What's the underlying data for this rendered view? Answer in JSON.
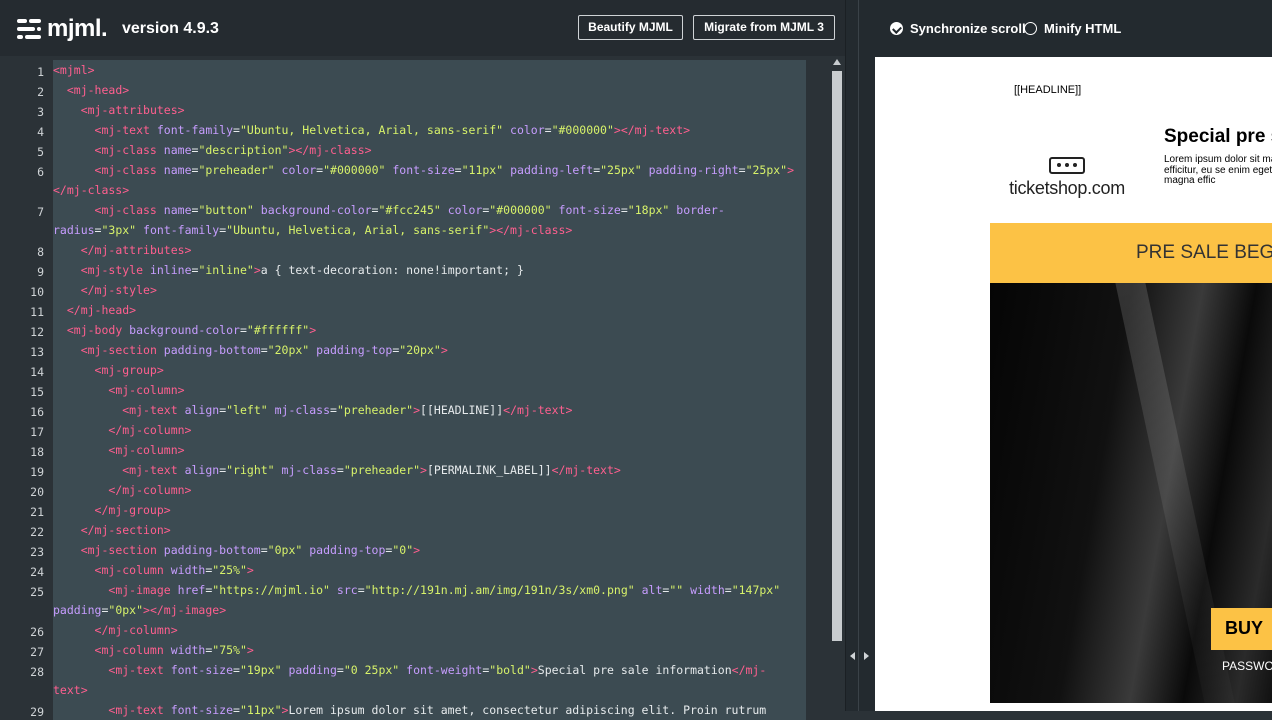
{
  "header": {
    "logo_text": "mjml.",
    "version": "version 4.9.3",
    "beautify_label": "Beautify MJML",
    "migrate_label": "Migrate from MJML 3"
  },
  "options": {
    "sync_scroll_label": "Synchronize scroll",
    "sync_scroll_checked": true,
    "minify_label": "Minify HTML",
    "minify_checked": false
  },
  "editor": {
    "line_numbers": [
      "1",
      "2",
      "3",
      "4",
      "5",
      "6",
      "7",
      "8",
      "9",
      "10",
      "11",
      "12",
      "13",
      "14",
      "15",
      "16",
      "17",
      "18",
      "19",
      "20",
      "21",
      "22",
      "23",
      "24",
      "25",
      "26",
      "27",
      "28",
      "29"
    ],
    "lines": [
      [
        [
          "t",
          "<mjml>"
        ]
      ],
      [
        [
          "x",
          "  "
        ],
        [
          "t",
          "<mj-head>"
        ]
      ],
      [
        [
          "x",
          "    "
        ],
        [
          "t",
          "<mj-attributes>"
        ]
      ],
      [
        [
          "x",
          "      "
        ],
        [
          "t",
          "<mj-text "
        ],
        [
          "a",
          "font-family"
        ],
        [
          "x",
          "="
        ],
        [
          "s",
          "\"Ubuntu, Helvetica, Arial, sans-serif\""
        ],
        [
          "x",
          " "
        ],
        [
          "a",
          "color"
        ],
        [
          "x",
          "="
        ],
        [
          "s",
          "\"#000000\""
        ],
        [
          "t",
          "></mj-text>"
        ]
      ],
      [
        [
          "x",
          "      "
        ],
        [
          "t",
          "<mj-class "
        ],
        [
          "a",
          "name"
        ],
        [
          "x",
          "="
        ],
        [
          "s",
          "\"description\""
        ],
        [
          "t",
          "></mj-class>"
        ]
      ],
      [
        [
          "x",
          "      "
        ],
        [
          "t",
          "<mj-class "
        ],
        [
          "a",
          "name"
        ],
        [
          "x",
          "="
        ],
        [
          "s",
          "\"preheader\""
        ],
        [
          "x",
          " "
        ],
        [
          "a",
          "color"
        ],
        [
          "x",
          "="
        ],
        [
          "s",
          "\"#000000\""
        ],
        [
          "x",
          " "
        ],
        [
          "a",
          "font-size"
        ],
        [
          "x",
          "="
        ],
        [
          "s",
          "\"11px\""
        ],
        [
          "x",
          " "
        ],
        [
          "a",
          "padding-left"
        ],
        [
          "x",
          "="
        ],
        [
          "s",
          "\"25px\""
        ],
        [
          "x",
          " "
        ],
        [
          "a",
          "padding-right"
        ],
        [
          "x",
          "="
        ],
        [
          "s",
          "\"25px\""
        ],
        [
          "t",
          ">"
        ]
      ],
      [
        [
          "t",
          "</mj-class>"
        ]
      ],
      [
        [
          "x",
          "      "
        ],
        [
          "t",
          "<mj-class "
        ],
        [
          "a",
          "name"
        ],
        [
          "x",
          "="
        ],
        [
          "s",
          "\"button\""
        ],
        [
          "x",
          " "
        ],
        [
          "a",
          "background-color"
        ],
        [
          "x",
          "="
        ],
        [
          "s",
          "\"#fcc245\""
        ],
        [
          "x",
          " "
        ],
        [
          "a",
          "color"
        ],
        [
          "x",
          "="
        ],
        [
          "s",
          "\"#000000\""
        ],
        [
          "x",
          " "
        ],
        [
          "a",
          "font-size"
        ],
        [
          "x",
          "="
        ],
        [
          "s",
          "\"18px\""
        ],
        [
          "x",
          " "
        ],
        [
          "a",
          "border-"
        ]
      ],
      [
        [
          "a",
          "radius"
        ],
        [
          "x",
          "="
        ],
        [
          "s",
          "\"3px\""
        ],
        [
          "x",
          " "
        ],
        [
          "a",
          "font-family"
        ],
        [
          "x",
          "="
        ],
        [
          "s",
          "\"Ubuntu, Helvetica, Arial, sans-serif\""
        ],
        [
          "t",
          "></mj-class>"
        ]
      ],
      [
        [
          "x",
          "    "
        ],
        [
          "t",
          "</mj-attributes>"
        ]
      ],
      [
        [
          "x",
          "    "
        ],
        [
          "t",
          "<mj-style "
        ],
        [
          "a",
          "inline"
        ],
        [
          "x",
          "="
        ],
        [
          "s",
          "\"inline\""
        ],
        [
          "t",
          ">"
        ],
        [
          "x",
          "a { text-decoration: none!important; }"
        ]
      ],
      [
        [
          "x",
          "    "
        ],
        [
          "t",
          "</mj-style>"
        ]
      ],
      [
        [
          "x",
          "  "
        ],
        [
          "t",
          "</mj-head>"
        ]
      ],
      [
        [
          "x",
          "  "
        ],
        [
          "t",
          "<mj-body "
        ],
        [
          "a",
          "background-color"
        ],
        [
          "x",
          "="
        ],
        [
          "s",
          "\"#ffffff\""
        ],
        [
          "t",
          ">"
        ]
      ],
      [
        [
          "x",
          "    "
        ],
        [
          "t",
          "<mj-section "
        ],
        [
          "a",
          "padding-bottom"
        ],
        [
          "x",
          "="
        ],
        [
          "s",
          "\"20px\""
        ],
        [
          "x",
          " "
        ],
        [
          "a",
          "padding-top"
        ],
        [
          "x",
          "="
        ],
        [
          "s",
          "\"20px\""
        ],
        [
          "t",
          ">"
        ]
      ],
      [
        [
          "x",
          "      "
        ],
        [
          "t",
          "<mj-group>"
        ]
      ],
      [
        [
          "x",
          "        "
        ],
        [
          "t",
          "<mj-column>"
        ]
      ],
      [
        [
          "x",
          "          "
        ],
        [
          "t",
          "<mj-text "
        ],
        [
          "a",
          "align"
        ],
        [
          "x",
          "="
        ],
        [
          "s",
          "\"left\""
        ],
        [
          "x",
          " "
        ],
        [
          "a",
          "mj-class"
        ],
        [
          "x",
          "="
        ],
        [
          "s",
          "\"preheader\""
        ],
        [
          "t",
          ">"
        ],
        [
          "x",
          "[[HEADLINE]]"
        ],
        [
          "t",
          "</mj-text>"
        ]
      ],
      [
        [
          "x",
          "        "
        ],
        [
          "t",
          "</mj-column>"
        ]
      ],
      [
        [
          "x",
          "        "
        ],
        [
          "t",
          "<mj-column>"
        ]
      ],
      [
        [
          "x",
          "          "
        ],
        [
          "t",
          "<mj-text "
        ],
        [
          "a",
          "align"
        ],
        [
          "x",
          "="
        ],
        [
          "s",
          "\"right\""
        ],
        [
          "x",
          " "
        ],
        [
          "a",
          "mj-class"
        ],
        [
          "x",
          "="
        ],
        [
          "s",
          "\"preheader\""
        ],
        [
          "t",
          ">"
        ],
        [
          "x",
          "[PERMALINK_LABEL]]"
        ],
        [
          "t",
          "</mj-text>"
        ]
      ],
      [
        [
          "x",
          "        "
        ],
        [
          "t",
          "</mj-column>"
        ]
      ],
      [
        [
          "x",
          "      "
        ],
        [
          "t",
          "</mj-group>"
        ]
      ],
      [
        [
          "x",
          "    "
        ],
        [
          "t",
          "</mj-section>"
        ]
      ],
      [
        [
          "x",
          "    "
        ],
        [
          "t",
          "<mj-section "
        ],
        [
          "a",
          "padding-bottom"
        ],
        [
          "x",
          "="
        ],
        [
          "s",
          "\"0px\""
        ],
        [
          "x",
          " "
        ],
        [
          "a",
          "padding-top"
        ],
        [
          "x",
          "="
        ],
        [
          "s",
          "\"0\""
        ],
        [
          "t",
          ">"
        ]
      ],
      [
        [
          "x",
          "      "
        ],
        [
          "t",
          "<mj-column "
        ],
        [
          "a",
          "width"
        ],
        [
          "x",
          "="
        ],
        [
          "s",
          "\"25%\""
        ],
        [
          "t",
          ">"
        ]
      ],
      [
        [
          "x",
          "        "
        ],
        [
          "t",
          "<mj-image "
        ],
        [
          "a",
          "href"
        ],
        [
          "x",
          "="
        ],
        [
          "s",
          "\"https://mjml.io\""
        ],
        [
          "x",
          " "
        ],
        [
          "a",
          "src"
        ],
        [
          "x",
          "="
        ],
        [
          "s",
          "\"http://191n.mj.am/img/191n/3s/xm0.png\""
        ],
        [
          "x",
          " "
        ],
        [
          "a",
          "alt"
        ],
        [
          "x",
          "="
        ],
        [
          "s",
          "\"\""
        ],
        [
          "x",
          " "
        ],
        [
          "a",
          "width"
        ],
        [
          "x",
          "="
        ],
        [
          "s",
          "\"147px\""
        ]
      ],
      [
        [
          "a",
          "padding"
        ],
        [
          "x",
          "="
        ],
        [
          "s",
          "\"0px\""
        ],
        [
          "t",
          "></mj-image>"
        ]
      ],
      [
        [
          "x",
          "      "
        ],
        [
          "t",
          "</mj-column>"
        ]
      ],
      [
        [
          "x",
          "      "
        ],
        [
          "t",
          "<mj-column "
        ],
        [
          "a",
          "width"
        ],
        [
          "x",
          "="
        ],
        [
          "s",
          "\"75%\""
        ],
        [
          "t",
          ">"
        ]
      ],
      [
        [
          "x",
          "        "
        ],
        [
          "t",
          "<mj-text "
        ],
        [
          "a",
          "font-size"
        ],
        [
          "x",
          "="
        ],
        [
          "s",
          "\"19px\""
        ],
        [
          "x",
          " "
        ],
        [
          "a",
          "padding"
        ],
        [
          "x",
          "="
        ],
        [
          "s",
          "\"0 25px\""
        ],
        [
          "x",
          " "
        ],
        [
          "a",
          "font-weight"
        ],
        [
          "x",
          "="
        ],
        [
          "s",
          "\"bold\""
        ],
        [
          "t",
          ">"
        ],
        [
          "x",
          "Special pre sale information"
        ],
        [
          "t",
          "</mj-"
        ]
      ],
      [
        [
          "t",
          "text>"
        ]
      ],
      [
        [
          "x",
          "        "
        ],
        [
          "t",
          "<mj-text "
        ],
        [
          "a",
          "font-size"
        ],
        [
          "x",
          "="
        ],
        [
          "s",
          "\"11px\""
        ],
        [
          "t",
          ">"
        ],
        [
          "x",
          "Lorem ipsum dolor sit amet, consectetur adipiscing elit. Proin rutrum"
        ]
      ]
    ]
  },
  "preview": {
    "headline": "[[HEADLINE]]",
    "title": "Special pre s",
    "body": "Lorem ipsum dolor sit magna efficitur, eu se enim eget magna effic",
    "logo_text": "ticketshop.com",
    "banner_text": "PRE SALE BEGI",
    "buy_label": "BUY",
    "password_label": "PASSWO",
    "accent_color": "#fcc245"
  }
}
